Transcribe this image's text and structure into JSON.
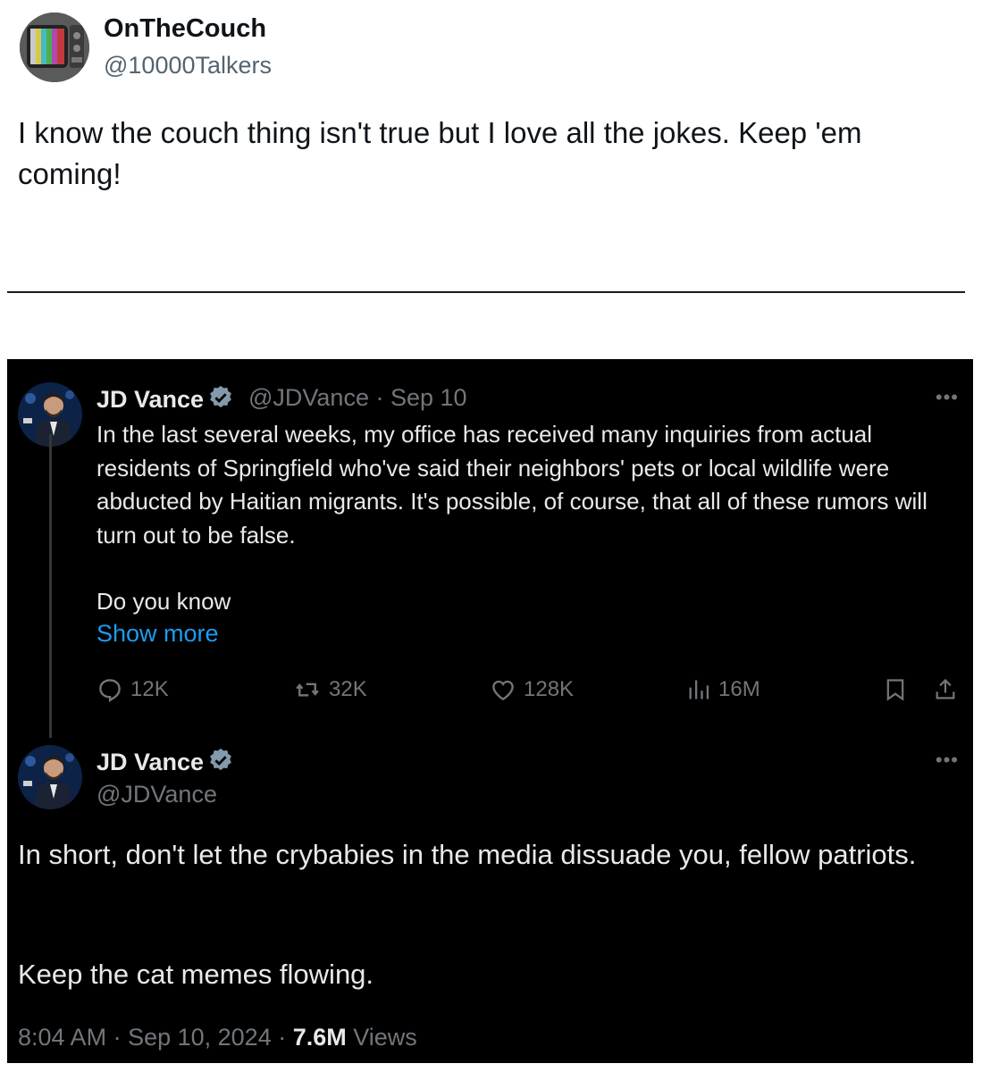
{
  "top_tweet": {
    "display_name": "OnTheCouch",
    "handle": "@10000Talkers",
    "text": "I know the couch thing isn't true but I love all the jokes.  Keep 'em coming!"
  },
  "embedded": {
    "first_post": {
      "display_name": "JD Vance",
      "handle": "@JDVance",
      "separator": "·",
      "date": "Sep 10",
      "text": "In the last several weeks, my office has received many inquiries from actual residents of Springfield who've said their neighbors' pets or local wildlife were abducted by Haitian migrants. It's possible, of course, that all of these rumors will turn out to be false.",
      "text_continued": "Do you know",
      "show_more_label": "Show more",
      "more_menu": "•••",
      "actions": {
        "replies": "12K",
        "reposts": "32K",
        "likes": "128K",
        "views": "16M"
      }
    },
    "second_post": {
      "display_name": "JD Vance",
      "handle": "@JDVance",
      "more_menu": "•••",
      "paragraph_1": "In short, don't let the crybabies in the media dissuade you, fellow patriots.",
      "paragraph_2": "Keep the cat memes flowing.",
      "time": "8:04 AM",
      "sep1": " · ",
      "date": "Sep 10, 2024",
      "sep2": " · ",
      "views_count": "7.6M",
      "views_label": " Views"
    }
  },
  "colors": {
    "link_blue": "#1d9bf0",
    "muted_gray": "#71767b",
    "dark_bg": "#000000",
    "verified_gray": "#829aab"
  }
}
